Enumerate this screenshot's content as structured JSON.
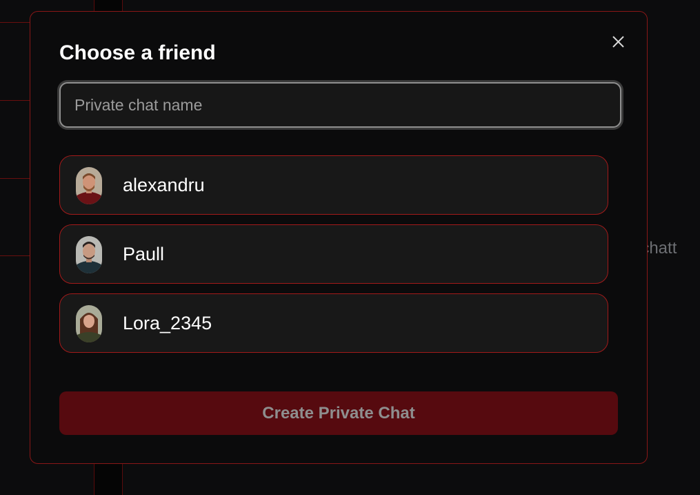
{
  "background": {
    "hint_text": "t chatt"
  },
  "modal": {
    "title": "Choose a friend",
    "close_icon": "close-icon",
    "input": {
      "placeholder": "Private chat name",
      "value": ""
    },
    "friends": [
      {
        "name": "alexandru",
        "avatar_icon": "avatar-photo"
      },
      {
        "name": "Paull",
        "avatar_icon": "avatar-photo"
      },
      {
        "name": "Lora_2345",
        "avatar_icon": "avatar-photo"
      }
    ],
    "create_button_label": "Create Private Chat"
  },
  "colors": {
    "accent": "#8a1717",
    "button_bg": "#560a0f",
    "panel_bg": "#0b0b0c",
    "item_bg": "#181818"
  }
}
